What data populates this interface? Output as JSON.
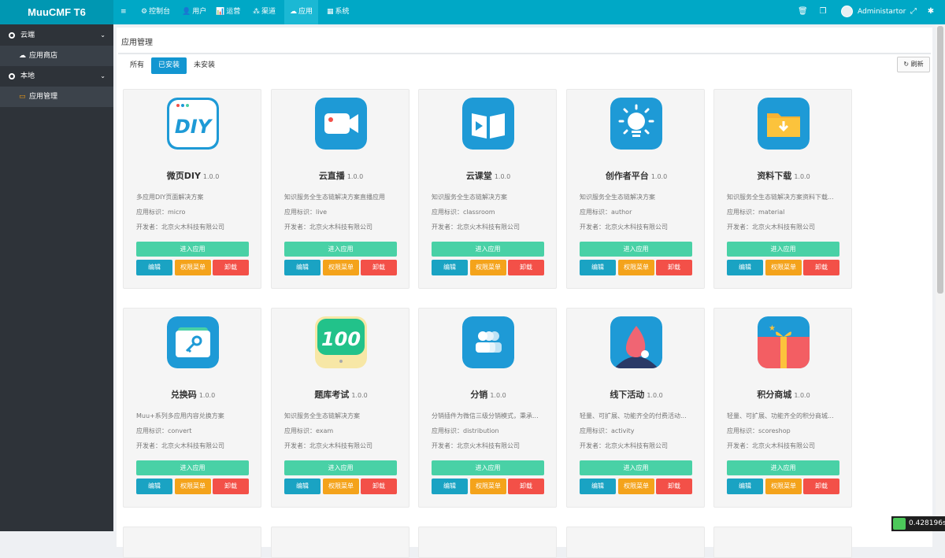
{
  "brand": "MuuCMF T6",
  "topnav": [
    {
      "id": "menu",
      "label": "",
      "icon": "≡"
    },
    {
      "id": "dashboard",
      "label": "控制台",
      "icon": "⚙"
    },
    {
      "id": "users",
      "label": "用户",
      "icon": "👤"
    },
    {
      "id": "operations",
      "label": "运营",
      "icon": "📊"
    },
    {
      "id": "channels",
      "label": "渠道",
      "icon": "⁂"
    },
    {
      "id": "apps",
      "label": "应用",
      "icon": "☁",
      "active": true
    },
    {
      "id": "system",
      "label": "系统",
      "icon": "▦"
    }
  ],
  "topright": {
    "username": "Administartor"
  },
  "sidebar": {
    "groups": [
      {
        "label": "云端",
        "items": [
          {
            "label": "应用商店"
          }
        ]
      },
      {
        "label": "本地",
        "items": [
          {
            "label": "应用管理"
          }
        ]
      }
    ]
  },
  "page": {
    "title": "应用管理",
    "tabs": [
      "所有",
      "已安装",
      "未安装"
    ],
    "active_tab": "已安装",
    "refresh": "刷新"
  },
  "labels": {
    "id_prefix": "应用标识：",
    "dev_prefix": "开发者：",
    "enter": "进入应用",
    "edit": "编辑",
    "perms": "权限菜单",
    "uninstall": "卸载"
  },
  "apps": [
    {
      "name": "微页DIY",
      "version": "1.0.0",
      "desc": "多应用DIY页面解决方案",
      "ident": "micro",
      "dev": "北京火木科技有限公司",
      "icon": "diy-icon"
    },
    {
      "name": "云直播",
      "version": "1.0.0",
      "desc": "知识服务全生态链解决方案直播应用",
      "ident": "live",
      "dev": "北京火木科技有限公司",
      "icon": "video-camera-icon"
    },
    {
      "name": "云课堂",
      "version": "1.0.0",
      "desc": "知识服务全生态链解决方案",
      "ident": "classroom",
      "dev": "北京火木科技有限公司",
      "icon": "open-book-icon"
    },
    {
      "name": "创作者平台",
      "version": "1.0.0",
      "desc": "知识服务全生态链解决方案",
      "ident": "author",
      "dev": "北京火木科技有限公司",
      "icon": "light-bulb-icon"
    },
    {
      "name": "资料下载",
      "version": "1.0.0",
      "desc": "知识服务全生态链解决方案资料下载...",
      "ident": "material",
      "dev": "北京火木科技有限公司",
      "icon": "folder-download-icon"
    },
    {
      "name": "兑换码",
      "version": "1.0.0",
      "desc": "Muu+系列多应用内容兑换方案",
      "ident": "convert",
      "dev": "北京火木科技有限公司",
      "icon": "key-card-icon"
    },
    {
      "name": "题库考试",
      "version": "1.0.0",
      "desc": "知识服务全生态链解决方案",
      "ident": "exam",
      "dev": "北京火木科技有限公司",
      "icon": "score-100-icon"
    },
    {
      "name": "分销",
      "version": "1.0.0",
      "desc": "分销插件为微信三级分销模式，秉承...",
      "ident": "distribution",
      "dev": "北京火木科技有限公司",
      "icon": "people-group-icon"
    },
    {
      "name": "线下活动",
      "version": "1.0.0",
      "desc": "轻量、可扩展、功能齐全的付费活动...",
      "ident": "activity",
      "dev": "北京火木科技有限公司",
      "icon": "flame-icon"
    },
    {
      "name": "积分商城",
      "version": "1.0.0",
      "desc": "轻量、可扩展、功能齐全的积分商城...",
      "ident": "scoreshop",
      "dev": "北京火木科技有限公司",
      "icon": "gift-box-icon"
    }
  ],
  "timer": "0.428196s",
  "colors": {
    "topbar": "#00a8c6",
    "sidebar": "#2e3339",
    "enter": "#49d1a6",
    "edit": "#1aa3c3",
    "perms": "#f4a31b",
    "uninstall": "#f35048",
    "tab_active": "#1296d1"
  }
}
